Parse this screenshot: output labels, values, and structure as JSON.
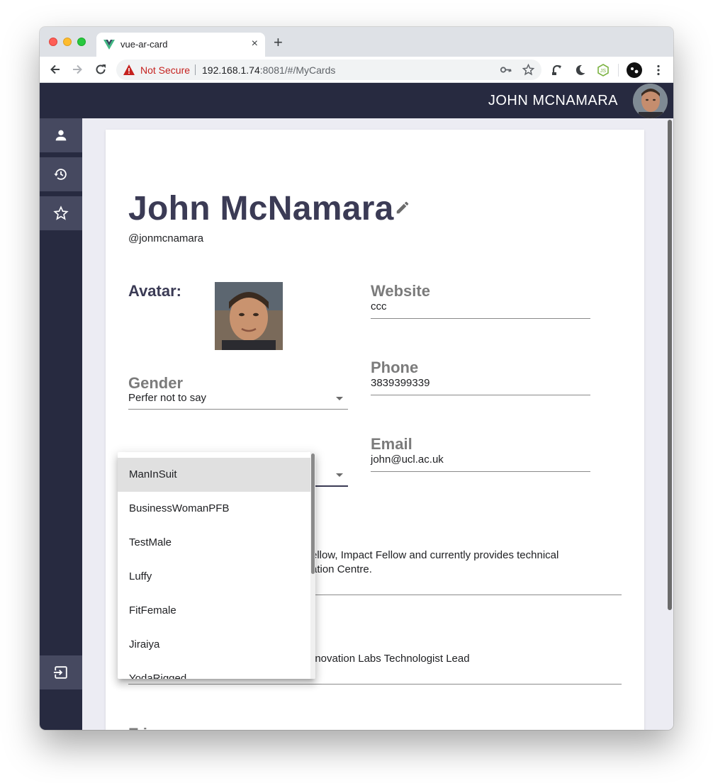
{
  "browser": {
    "tab_title": "vue-ar-card",
    "tab_close": "×",
    "new_tab": "+",
    "security_label": "Not Secure",
    "url_host": "192.168.1.74",
    "url_rest": ":8081/#/MyCards"
  },
  "appbar": {
    "user_name": "JOHN MCNAMARA"
  },
  "sidebar": {
    "items": [
      {
        "icon": "person-icon",
        "active": true
      },
      {
        "icon": "history-icon",
        "active": false
      },
      {
        "icon": "star-outline-icon",
        "active": false
      }
    ],
    "bottom_icon": "logout-icon"
  },
  "profile": {
    "name": "John McNamara",
    "handle": "@jonmcnamara",
    "avatar_label": "Avatar:",
    "website_label": "Website",
    "website_value": "ccc",
    "gender_label": "Gender",
    "gender_value": "Perfer not to say",
    "phone_label": "Phone",
    "phone_value": "3839399339",
    "email_label": "Email",
    "email_value": "john@ucl.ac.uk",
    "bio_line1": "ellow, Impact Fellow and currently provides technical",
    "bio_line2": "ation Centre.",
    "role_text": "nnovation Labs Technologist Lead",
    "next_label": "E     i"
  },
  "dropdown": {
    "options": [
      "ManInSuit",
      "BusinessWomanPFB",
      "TestMale",
      "Luffy",
      "FitFemale",
      "Jiraiya",
      "YodaRigged"
    ],
    "highlighted": "ManInSuit"
  },
  "colors": {
    "appbar": "#272a40",
    "accent_text": "#3b3b55",
    "page_bg": "#ececf3"
  }
}
